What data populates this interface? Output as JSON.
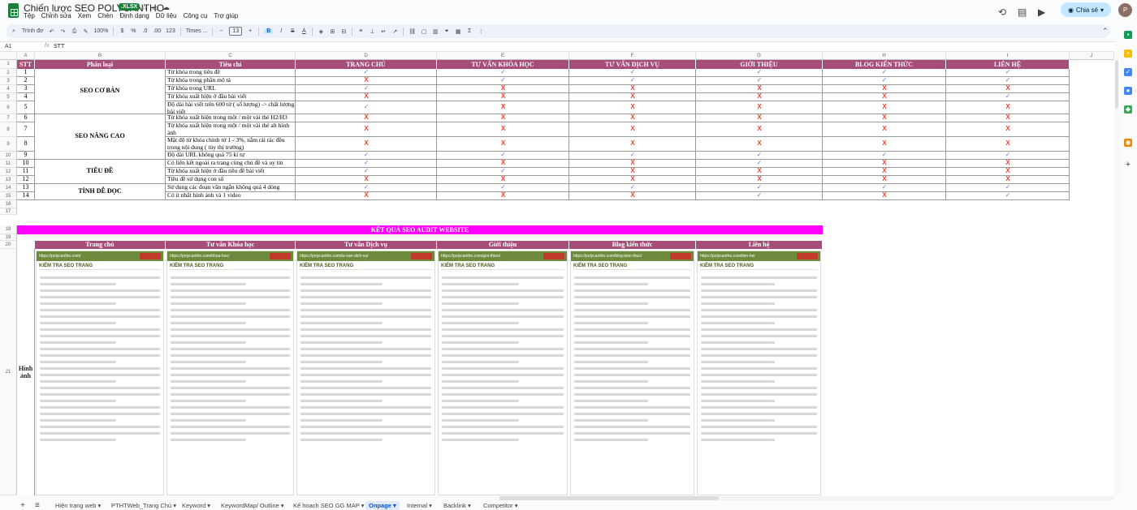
{
  "app": {
    "title": "Chiến lược SEO POLYCANTHO",
    "badge": ".XLSX",
    "menu": [
      "Tệp",
      "Chỉnh sửa",
      "Xem",
      "Chèn",
      "Định dạng",
      "Dữ liệu",
      "Công cụ",
      "Trợ giúp"
    ],
    "share_label": "Chia sẻ"
  },
  "toolbar": {
    "search": "Trình đơ",
    "zoom": "100%",
    "currency": "$",
    "percent": "%",
    "dec_less": ".0",
    "dec_more": ".00",
    "num_format": "123",
    "font": "Times ...",
    "font_size": "13",
    "bold": "B"
  },
  "formula_bar": {
    "cell": "A1",
    "fx": "fx",
    "value": "STT"
  },
  "columns": [
    "A",
    "B",
    "C",
    "D",
    "E",
    "F",
    "G",
    "H",
    "I",
    "J"
  ],
  "header": [
    "STT",
    "Phân loại",
    "Tiêu chí",
    "TRANG CHỦ",
    "TƯ VẤN KHÓA HỌC",
    "TƯ VẤN DỊCH VỤ",
    "GIỚI THIỆU",
    "BLOG KIẾN THỨC",
    "LIÊN HỆ"
  ],
  "categories": [
    {
      "label": "SEO CƠ BẢN"
    },
    {
      "label": "SEO NÂNG CAO"
    },
    {
      "label": "TIÊU ĐỀ"
    },
    {
      "label": "TÍNH DỄ ĐỌC"
    }
  ],
  "criteria": [
    {
      "stt": "1",
      "text": "Từ khóa trong tiêu đề",
      "marks": [
        "ok",
        "ok",
        "ok",
        "ok",
        "ok",
        "ok"
      ]
    },
    {
      "stt": "2",
      "text": "Từ khóa trong phần mô tả",
      "marks": [
        "no",
        "ok",
        "ok",
        "ok",
        "ok",
        "ok"
      ]
    },
    {
      "stt": "3",
      "text": "Từ khóa trong URL",
      "marks": [
        "ok",
        "no",
        "no",
        "no",
        "no",
        "no"
      ]
    },
    {
      "stt": "4",
      "text": "Từ khóa xuất hiện ở đầu bài viết",
      "marks": [
        "no",
        "no",
        "no",
        "no",
        "no",
        "ok"
      ]
    },
    {
      "stt": "5",
      "text": "Độ dài bài viết trên 600 từ ( số lượng) -> chất lượng bài viết",
      "marks": [
        "ok",
        "no",
        "no",
        "no",
        "no",
        "no"
      ]
    },
    {
      "stt": "6",
      "text": "Từ khóa xuất hiện trong một / một vài thẻ H2/H3",
      "marks": [
        "no",
        "no",
        "no",
        "no",
        "no",
        "no"
      ]
    },
    {
      "stt": "7",
      "text": "Từ khóa xuất hiện trong một / một vài thẻ alt hình ảnh",
      "marks": [
        "no",
        "no",
        "no",
        "no",
        "no",
        "no"
      ]
    },
    {
      "stt": "8",
      "text": "Mật độ từ khóa chính từ 1 - 3%, nằm rải rác đều trong nội dung ( tùy thị trường)",
      "marks": [
        "no",
        "no",
        "no",
        "no",
        "no",
        "no"
      ]
    },
    {
      "stt": "9",
      "text": "Độ dài URL không quá 75 kí tự",
      "marks": [
        "ok",
        "ok",
        "ok",
        "ok",
        "ok",
        "ok"
      ]
    },
    {
      "stt": "10",
      "text": "Có liên kết ngoài ra trang cùng chủ đề và uy tín",
      "marks": [
        "ok",
        "no",
        "no",
        "ok",
        "no",
        "no"
      ]
    },
    {
      "stt": "11",
      "text": "Từ khóa xuất hiện ở đầu tiêu đề bài viết",
      "marks": [
        "ok",
        "ok",
        "no",
        "no",
        "no",
        "no"
      ]
    },
    {
      "stt": "12",
      "text": "Tiêu đề sử dụng con số",
      "marks": [
        "no",
        "no",
        "no",
        "no",
        "no",
        "no"
      ]
    },
    {
      "stt": "13",
      "text": "Sử dụng các đoạn văn ngắn không quá 4 dòng",
      "marks": [
        "ok",
        "ok",
        "ok",
        "ok",
        "ok",
        "ok"
      ]
    },
    {
      "stt": "14",
      "text": "Có ít nhất hình ảnh và 1 video",
      "marks": [
        "no",
        "no",
        "no",
        "ok",
        "no",
        "ok"
      ]
    }
  ],
  "mark_symbols": {
    "ok": "✓",
    "no": "X"
  },
  "banner": "KẾT QUẢ SEO AUDIT WEBSITE",
  "page_headers": [
    "Trang chủ",
    "Tư vấn Khóa học",
    "Tư vấn Dịch vụ",
    "Giới thiệu",
    "Blog kiến thức",
    "Liên hệ"
  ],
  "image_label": "Hình ảnh",
  "screenshots": [
    {
      "url": "https://polycantho.com/",
      "title": "KIỂM TRA SEO TRANG"
    },
    {
      "url": "https://polycantho.com/khoa-hoc/",
      "title": "KIỂM TRA SEO TRANG"
    },
    {
      "url": "https://polycantho.com/tu-van-dich-vu/",
      "title": "KIỂM TRA SEO TRANG"
    },
    {
      "url": "https://polycantho.com/gioi-thieu/",
      "title": "KIỂM TRA SEO TRANG"
    },
    {
      "url": "https://polycantho.com/blog-kien-thuc/",
      "title": "KIỂM TRA SEO TRANG"
    },
    {
      "url": "https://polycantho.com/lien-he/",
      "title": "KIỂM TRA SEO TRANG"
    }
  ],
  "tabs": [
    "Hiện trạng web",
    "PTHTWeb_Trang Chủ",
    "Keyword",
    "KeywordMap/ Outline",
    "Kế hoạch SEO GG MAP",
    "Onpage",
    "Internal",
    "Backlink",
    "Competitor"
  ],
  "active_tab": "Onpage",
  "colors": {
    "header": "#a64d79",
    "banner": "#ff00ff",
    "ok": "#4285f4",
    "no": "#ea4335"
  }
}
